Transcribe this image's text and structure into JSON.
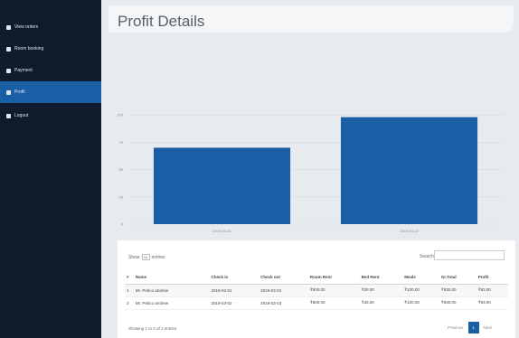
{
  "sidebar": {
    "items": [
      {
        "label": "View orders",
        "icon": "list-icon",
        "active": false
      },
      {
        "label": "Room booking",
        "icon": "calendar-icon",
        "active": false
      },
      {
        "label": "Payment",
        "icon": "card-icon",
        "active": false
      },
      {
        "label": "Profit",
        "icon": "chart-icon",
        "active": true
      },
      {
        "label": "Logout",
        "icon": "logout-icon",
        "active": false
      }
    ]
  },
  "header": {
    "title": "Profit Details"
  },
  "chart_data": {
    "type": "bar",
    "categories": [
      "2019-03-01",
      "2019-03-02"
    ],
    "values": [
      70,
      98
    ],
    "ylim": [
      0,
      125
    ],
    "yticks": [
      0,
      25,
      50,
      75,
      100
    ],
    "grid": true,
    "bar_color": "#1a5ea6"
  },
  "table": {
    "show_prefix": "Show",
    "show_value": "10",
    "show_suffix": "entries",
    "search_label": "Search:",
    "search_value": "",
    "columns": [
      "#",
      "Name",
      "Check in",
      "Check out",
      "Room Rent",
      "Bed Rent",
      "Meals",
      "Gr.Total",
      "Profit"
    ],
    "rows": [
      [
        "1",
        "Mr. Pebco andrew",
        "2019-03-01",
        "2019-03-02",
        "₹800.00",
        "₹30.00",
        "₹100.00",
        "₹930.00",
        "₹93.00"
      ],
      [
        "2",
        "Mr. Pebco andrew",
        "2019-03-02",
        "2019-03-03",
        "₹800.00",
        "₹30.00",
        "₹100.00",
        "₹930.00",
        "₹93.00"
      ]
    ],
    "info": "Showing 1 to 2 of 2 entries",
    "prev_label": "Previous",
    "page": "1",
    "next_label": "Next"
  },
  "colors": {
    "sidebar_bg": "#0f1a2c",
    "accent": "#1a5ea6",
    "content_bg": "#e7ebf0"
  }
}
